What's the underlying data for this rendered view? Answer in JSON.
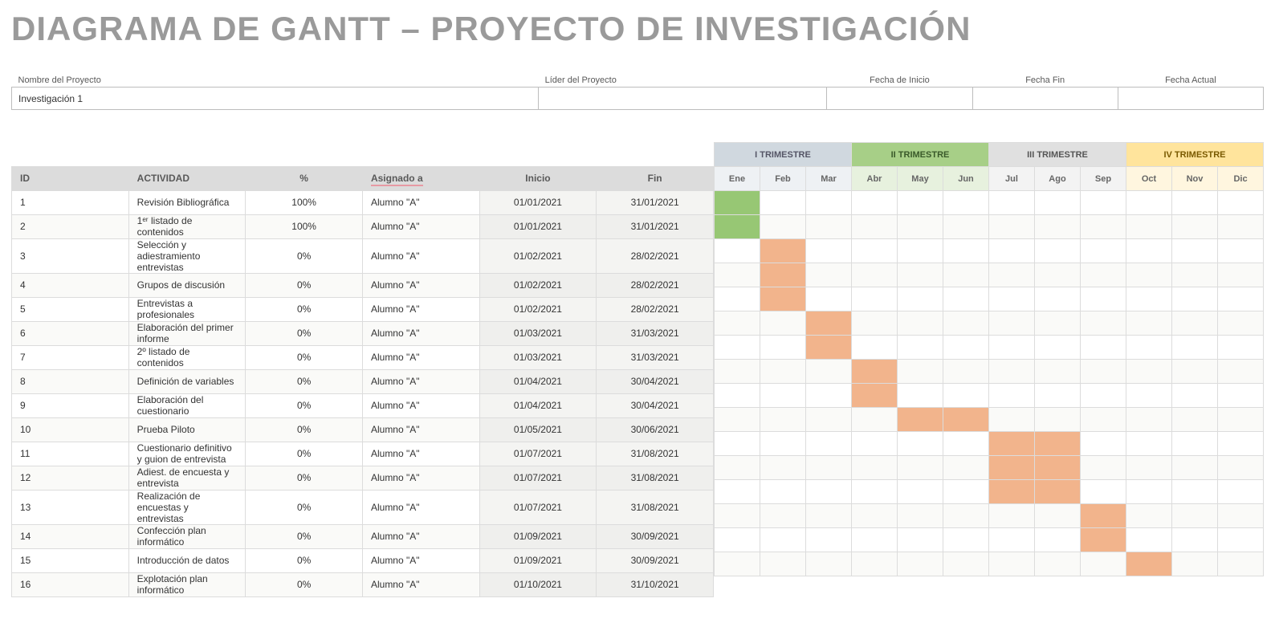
{
  "title": "DIAGRAMA DE GANTT – PROYECTO DE INVESTIGACIÓN",
  "meta": {
    "labels": {
      "project_name": "Nombre del Proyecto",
      "project_leader": "Líder del Proyecto",
      "start_date": "Fecha de Inicio",
      "end_date": "Fecha Fin",
      "current_date": "Fecha Actual"
    },
    "values": {
      "project_name": "Investigación 1",
      "project_leader": "",
      "start_date": "",
      "end_date": "",
      "current_date": ""
    }
  },
  "headers": {
    "id": "ID",
    "activity": "ACTIVIDAD",
    "pct": "%",
    "assigned": "Asignado a",
    "start": "Inicio",
    "end": "Fin"
  },
  "quarters": [
    {
      "label": "I TRIMESTRE",
      "class": "q1"
    },
    {
      "label": "II TRIMESTRE",
      "class": "q2"
    },
    {
      "label": "III TRIMESTRE",
      "class": "q3"
    },
    {
      "label": "IV TRIMESTRE",
      "class": "q4"
    }
  ],
  "months": [
    {
      "label": "Ene",
      "class": "q1"
    },
    {
      "label": "Feb",
      "class": "q1"
    },
    {
      "label": "Mar",
      "class": "q1"
    },
    {
      "label": "Abr",
      "class": "q2"
    },
    {
      "label": "May",
      "class": "q2"
    },
    {
      "label": "Jun",
      "class": "q2"
    },
    {
      "label": "Jul",
      "class": "q3"
    },
    {
      "label": "Ago",
      "class": "q3"
    },
    {
      "label": "Sep",
      "class": "q3"
    },
    {
      "label": "Oct",
      "class": "q4"
    },
    {
      "label": "Nov",
      "class": "q4"
    },
    {
      "label": "Dic",
      "class": "q4"
    }
  ],
  "tasks": [
    {
      "id": "1",
      "activity": "Revisión Bibliográfica",
      "pct": "100%",
      "assigned": "Alumno \"A\"",
      "start": "01/01/2021",
      "end": "31/01/2021",
      "bars": [
        {
          "m": 0,
          "s": "done"
        }
      ]
    },
    {
      "id": "2",
      "activity": "1ᵉʳ listado de contenidos",
      "pct": "100%",
      "assigned": "Alumno \"A\"",
      "start": "01/01/2021",
      "end": "31/01/2021",
      "bars": [
        {
          "m": 0,
          "s": "done"
        }
      ]
    },
    {
      "id": "3",
      "activity": "Selección y adiestramiento entrevistas",
      "pct": "0%",
      "assigned": "Alumno \"A\"",
      "start": "01/02/2021",
      "end": "28/02/2021",
      "bars": [
        {
          "m": 1,
          "s": "plan"
        }
      ]
    },
    {
      "id": "4",
      "activity": "Grupos de discusión",
      "pct": "0%",
      "assigned": "Alumno \"A\"",
      "start": "01/02/2021",
      "end": "28/02/2021",
      "bars": [
        {
          "m": 1,
          "s": "plan"
        }
      ]
    },
    {
      "id": "5",
      "activity": "Entrevistas a profesionales",
      "pct": "0%",
      "assigned": "Alumno \"A\"",
      "start": "01/02/2021",
      "end": "28/02/2021",
      "bars": [
        {
          "m": 1,
          "s": "plan"
        }
      ]
    },
    {
      "id": "6",
      "activity": "Elaboración del primer informe",
      "pct": "0%",
      "assigned": "Alumno \"A\"",
      "start": "01/03/2021",
      "end": "31/03/2021",
      "bars": [
        {
          "m": 2,
          "s": "plan"
        }
      ]
    },
    {
      "id": "7",
      "activity": "2º listado de contenidos",
      "pct": "0%",
      "assigned": "Alumno \"A\"",
      "start": "01/03/2021",
      "end": "31/03/2021",
      "bars": [
        {
          "m": 2,
          "s": "plan"
        }
      ]
    },
    {
      "id": "8",
      "activity": "Definición de variables",
      "pct": "0%",
      "assigned": "Alumno \"A\"",
      "start": "01/04/2021",
      "end": "30/04/2021",
      "bars": [
        {
          "m": 3,
          "s": "plan"
        }
      ]
    },
    {
      "id": "9",
      "activity": "Elaboración del cuestionario",
      "pct": "0%",
      "assigned": "Alumno \"A\"",
      "start": "01/04/2021",
      "end": "30/04/2021",
      "bars": [
        {
          "m": 3,
          "s": "plan"
        }
      ]
    },
    {
      "id": "10",
      "activity": "Prueba Piloto",
      "pct": "0%",
      "assigned": "Alumno \"A\"",
      "start": "01/05/2021",
      "end": "30/06/2021",
      "bars": [
        {
          "m": 4,
          "s": "plan"
        },
        {
          "m": 5,
          "s": "plan"
        }
      ]
    },
    {
      "id": "11",
      "activity": "Cuestionario definitivo y guion de entrevista",
      "pct": "0%",
      "assigned": "Alumno \"A\"",
      "start": "01/07/2021",
      "end": "31/08/2021",
      "bars": [
        {
          "m": 6,
          "s": "plan"
        },
        {
          "m": 7,
          "s": "plan"
        }
      ]
    },
    {
      "id": "12",
      "activity": "Adiest. de encuesta y entrevista",
      "pct": "0%",
      "assigned": "Alumno \"A\"",
      "start": "01/07/2021",
      "end": "31/08/2021",
      "bars": [
        {
          "m": 6,
          "s": "plan"
        },
        {
          "m": 7,
          "s": "plan"
        }
      ]
    },
    {
      "id": "13",
      "activity": "Realización de encuestas y entrevistas",
      "pct": "0%",
      "assigned": "Alumno \"A\"",
      "start": "01/07/2021",
      "end": "31/08/2021",
      "bars": [
        {
          "m": 6,
          "s": "plan"
        },
        {
          "m": 7,
          "s": "plan"
        }
      ]
    },
    {
      "id": "14",
      "activity": "Confección plan informático",
      "pct": "0%",
      "assigned": "Alumno \"A\"",
      "start": "01/09/2021",
      "end": "30/09/2021",
      "bars": [
        {
          "m": 8,
          "s": "plan"
        }
      ]
    },
    {
      "id": "15",
      "activity": "Introducción de datos",
      "pct": "0%",
      "assigned": "Alumno \"A\"",
      "start": "01/09/2021",
      "end": "30/09/2021",
      "bars": [
        {
          "m": 8,
          "s": "plan"
        }
      ]
    },
    {
      "id": "16",
      "activity": "Explotación plan informático",
      "pct": "0%",
      "assigned": "Alumno \"A\"",
      "start": "01/10/2021",
      "end": "31/10/2021",
      "bars": [
        {
          "m": 9,
          "s": "plan"
        }
      ]
    }
  ]
}
